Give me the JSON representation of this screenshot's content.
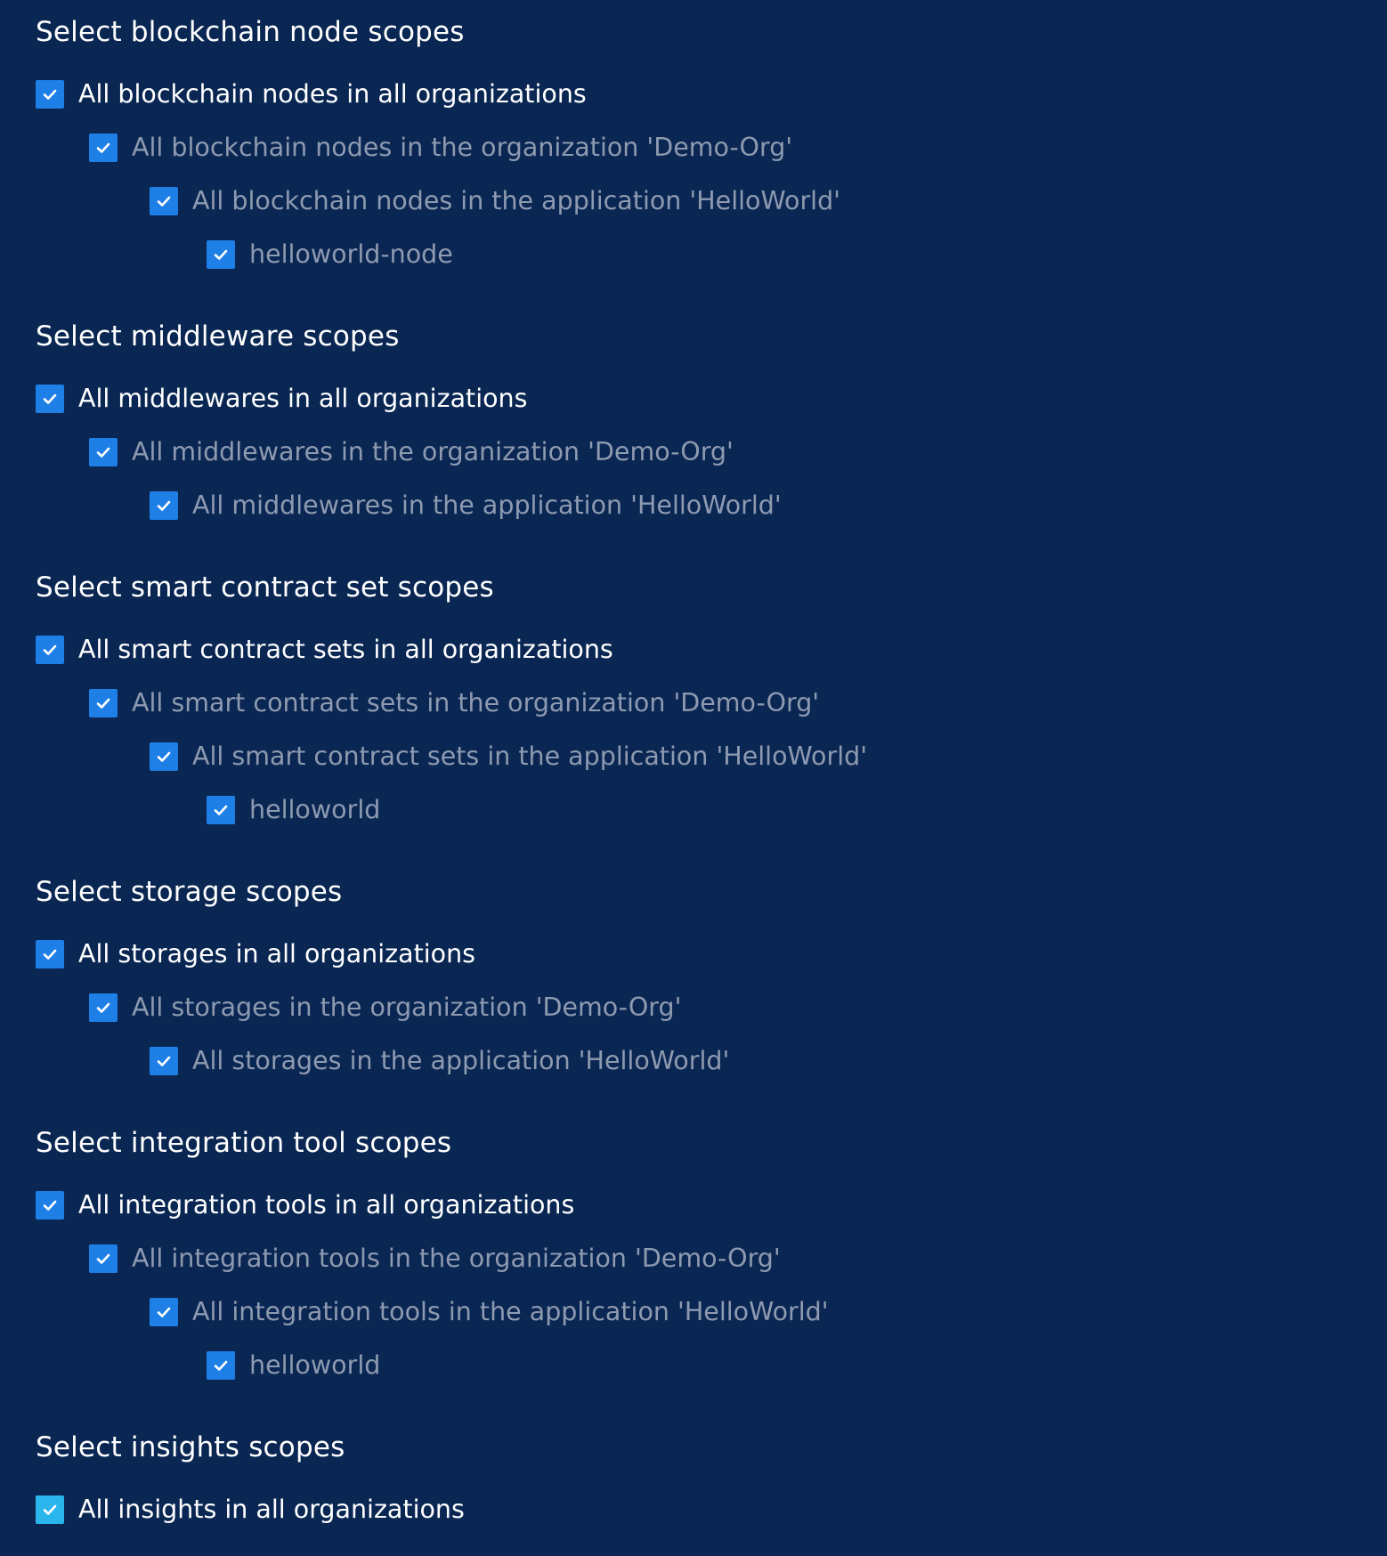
{
  "sections": [
    {
      "title": "Select blockchain node scopes",
      "options": [
        {
          "label": "All blockchain nodes in all organizations"
        },
        {
          "label": "All blockchain nodes in the organization 'Demo-Org'"
        },
        {
          "label": "All blockchain nodes in the application 'HelloWorld'"
        },
        {
          "label": "helloworld-node"
        }
      ]
    },
    {
      "title": "Select middleware scopes",
      "options": [
        {
          "label": "All middlewares in all organizations"
        },
        {
          "label": "All middlewares in the organization 'Demo-Org'"
        },
        {
          "label": "All middlewares in the application 'HelloWorld'"
        }
      ]
    },
    {
      "title": "Select smart contract set scopes",
      "options": [
        {
          "label": "All smart contract sets in all organizations"
        },
        {
          "label": "All smart contract sets in the organization 'Demo-Org'"
        },
        {
          "label": "All smart contract sets in the application 'HelloWorld'"
        },
        {
          "label": "helloworld"
        }
      ]
    },
    {
      "title": "Select storage scopes",
      "options": [
        {
          "label": "All storages in all organizations"
        },
        {
          "label": "All storages in the organization 'Demo-Org'"
        },
        {
          "label": "All storages in the application 'HelloWorld'"
        }
      ]
    },
    {
      "title": "Select integration tool scopes",
      "options": [
        {
          "label": "All integration tools in all organizations"
        },
        {
          "label": "All integration tools in the organization 'Demo-Org'"
        },
        {
          "label": "All integration tools in the application 'HelloWorld'"
        },
        {
          "label": "helloworld"
        }
      ]
    },
    {
      "title": "Select insights scopes",
      "options": [
        {
          "label": "All insights in all organizations"
        }
      ]
    }
  ],
  "colors": {
    "background": "#0a2754",
    "checkbox": "#1e7fe6",
    "checkbox_accent": "#2ab5ec",
    "label_primary": "#ffffff",
    "label_secondary": "#8e9ab0"
  },
  "icons": {
    "checkbox_checked": "check-icon"
  }
}
